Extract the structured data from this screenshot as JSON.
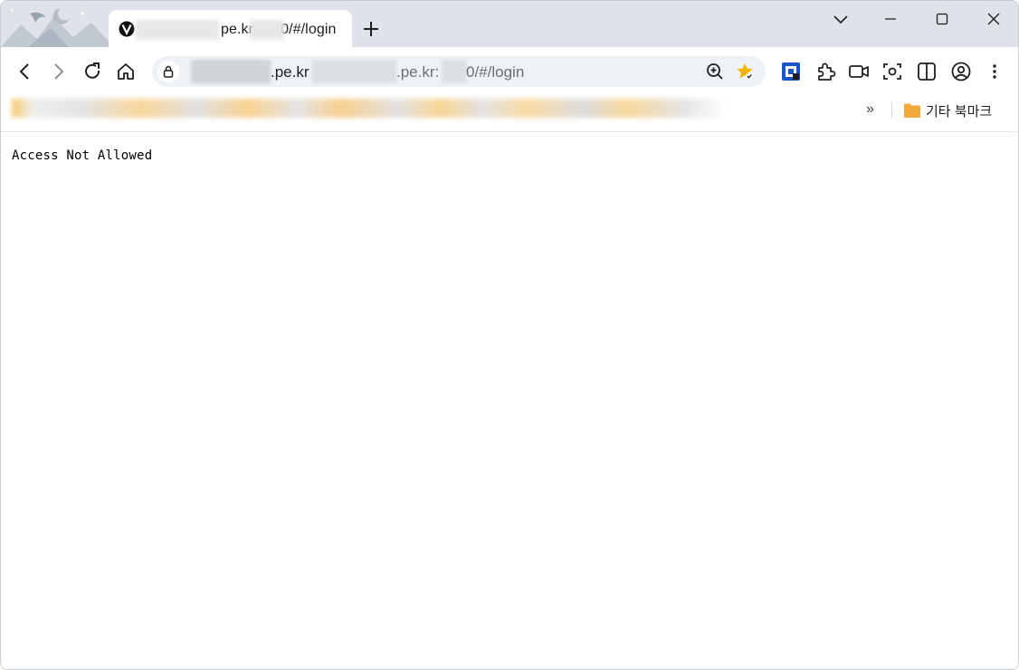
{
  "tab": {
    "title_suffix": "pe.kr",
    "title_end": "0/#/login",
    "new_tab_icon": "plus-icon"
  },
  "address_bar": {
    "host_part": ".pe.kr",
    "port_part": ".pe.kr:",
    "path_part": "0/#/login"
  },
  "toolbar": {
    "icons": [
      "back-icon",
      "forward-icon",
      "reload-icon",
      "home-icon",
      "lock-icon",
      "zoom-icon",
      "bookmark-star-icon",
      "extension-badge-icon",
      "puzzle-icon",
      "video-icon",
      "screenshot-icon",
      "split-view-icon",
      "profile-icon",
      "menu-icon"
    ]
  },
  "bookmarks_bar": {
    "overflow_label": "»",
    "folder_label": "기타 북마크"
  },
  "page": {
    "message": "Access Not Allowed"
  },
  "colors": {
    "tabstrip": "#dfe3e9",
    "omnibox": "#eef1f6",
    "star": "#f4b400",
    "folder": "#f2a93b",
    "extension": "#1a56c9"
  }
}
